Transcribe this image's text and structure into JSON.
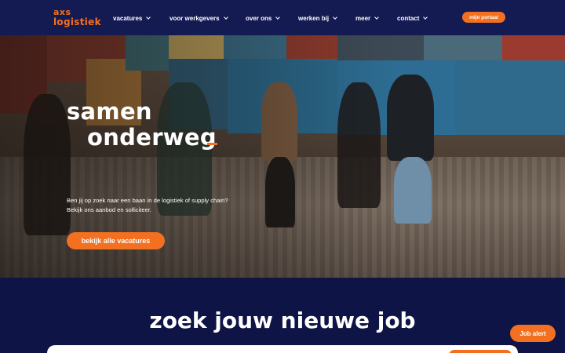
{
  "brand": {
    "logo_line1": "axs",
    "logo_line2": "logistiek"
  },
  "nav": {
    "items": [
      {
        "label": "vacatures"
      },
      {
        "label": "voor werkgevers"
      },
      {
        "label": "over ons"
      },
      {
        "label": "werken bij"
      },
      {
        "label": "meer"
      },
      {
        "label": "contact"
      }
    ],
    "portal_label": "mijn portaal"
  },
  "hero": {
    "headline_line1": "samen",
    "headline_line2": "onderweg",
    "intro": "Ben jij op zoek naar een baan in de logistiek of supply chain? Bekijk ons aanbod en solliciteer.",
    "cta_label": "bekijk alle vacatures"
  },
  "search": {
    "title": "zoek jouw nieuwe job"
  },
  "floating": {
    "job_alert_label": "Job alert"
  },
  "colors": {
    "accent": "#f37021",
    "navy": "#0e1445",
    "header": "#141a52"
  }
}
